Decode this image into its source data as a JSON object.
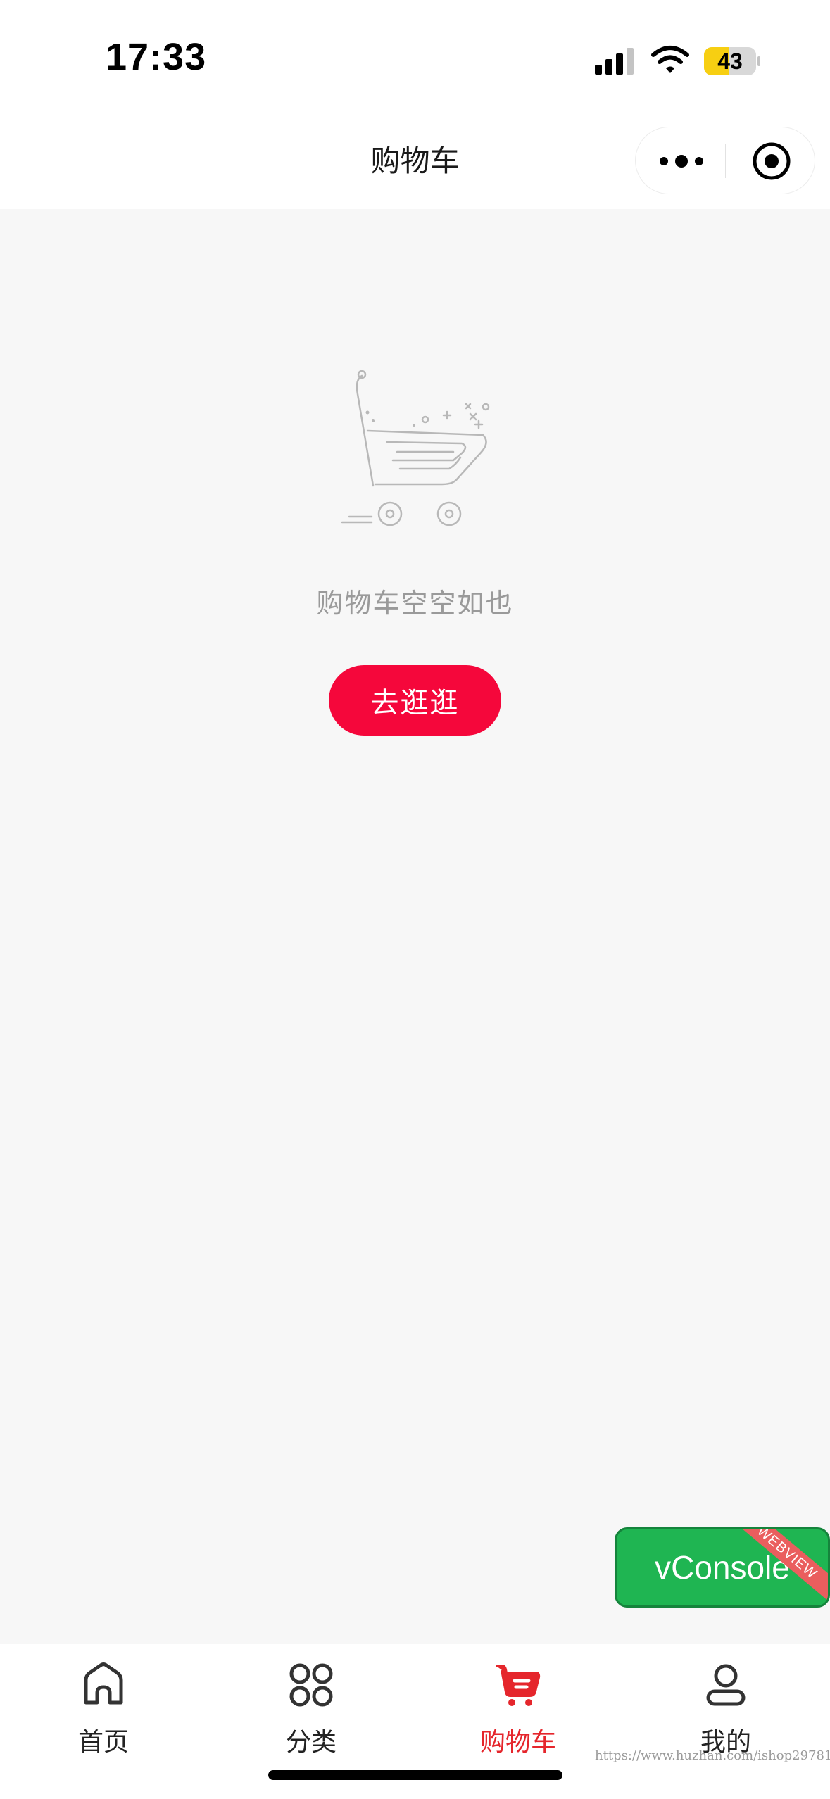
{
  "status_bar": {
    "time": "17:33",
    "battery_level": "43"
  },
  "nav": {
    "title": "购物车"
  },
  "empty_state": {
    "icon": "empty-cart-illustration",
    "message": "购物车空空如也",
    "button_label": "去逛逛"
  },
  "debug": {
    "vconsole_label": "vConsole",
    "ribbon_label": "WEBVIEW"
  },
  "tabs": [
    {
      "label": "首页",
      "icon": "home-icon",
      "active": false
    },
    {
      "label": "分类",
      "icon": "grid-icon",
      "active": false
    },
    {
      "label": "购物车",
      "icon": "cart-icon",
      "active": true
    },
    {
      "label": "我的",
      "icon": "user-icon",
      "active": false
    }
  ],
  "watermark": "https://www.huzhan.com/ishop29781",
  "colors": {
    "accent": "#f5073b",
    "tab_active": "#e5262c",
    "vconsole": "#1fb552"
  }
}
